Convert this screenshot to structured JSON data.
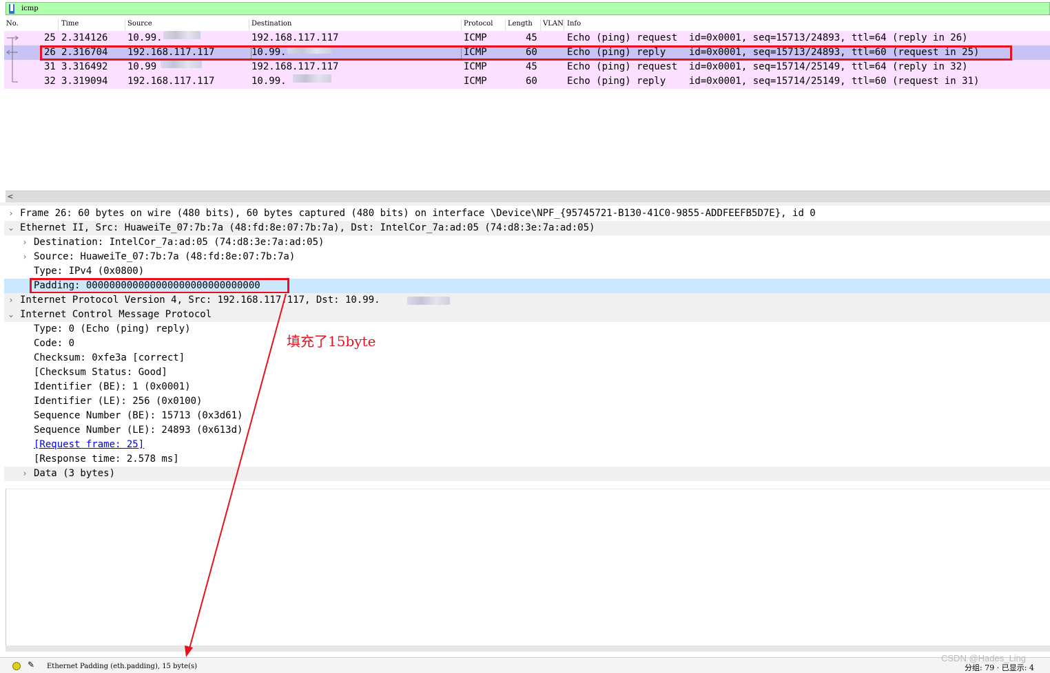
{
  "filter": {
    "value": "icmp",
    "bookmark_icon": "bookmark-icon"
  },
  "colors": {
    "filter_bg": "#afffaf",
    "row_icmp": "#fce0ff",
    "row_selected": "#c9c3f5",
    "detail_selected": "#cce8ff",
    "highlight_red": "#e8101e"
  },
  "packet_list": {
    "columns": [
      "No.",
      "Time",
      "Source",
      "Destination",
      "Protocol",
      "Length",
      "VLAN",
      "Info"
    ],
    "rows": [
      {
        "no": "25",
        "time": "2.314126",
        "source": "10.99.",
        "destination": "192.168.117.117",
        "protocol": "ICMP",
        "length": "45",
        "vlan": "",
        "info": "Echo (ping) request  id=0x0001, seq=15713/24893, ttl=64 (reply in 26)"
      },
      {
        "no": "26",
        "time": "2.316704",
        "source": "192.168.117.117",
        "destination": "10.99.",
        "protocol": "ICMP",
        "length": "60",
        "vlan": "",
        "info": "Echo (ping) reply    id=0x0001, seq=15713/24893, ttl=60 (request in 25)"
      },
      {
        "no": "31",
        "time": "3.316492",
        "source": "10.99",
        "destination": "192.168.117.117",
        "protocol": "ICMP",
        "length": "45",
        "vlan": "",
        "info": "Echo (ping) request  id=0x0001, seq=15714/25149, ttl=64 (reply in 32)"
      },
      {
        "no": "32",
        "time": "3.319094",
        "source": "192.168.117.117",
        "destination": "10.99.",
        "protocol": "ICMP",
        "length": "60",
        "vlan": "",
        "info": "Echo (ping) reply    id=0x0001, seq=15714/25149, ttl=60 (request in 31)"
      }
    ],
    "scroll_left": "<"
  },
  "details": {
    "frame": "Frame 26: 60 bytes on wire (480 bits), 60 bytes captured (480 bits) on interface \\Device\\NPF_{95745721-B130-41C0-9855-ADDFEEFB5D7E}, id 0",
    "ethernet": "Ethernet II, Src: HuaweiTe_07:7b:7a (48:fd:8e:07:7b:7a), Dst: IntelCor_7a:ad:05 (74:d8:3e:7a:ad:05)",
    "eth_dst": "Destination: IntelCor_7a:ad:05 (74:d8:3e:7a:ad:05)",
    "eth_src": "Source: HuaweiTe_07:7b:7a (48:fd:8e:07:7b:7a)",
    "eth_type": "Type: IPv4 (0x0800)",
    "eth_padding": "Padding: 000000000000000000000000000000",
    "ip": "Internet Protocol Version 4, Src: 192.168.117.117, Dst: 10.99.",
    "icmp": "Internet Control Message Protocol",
    "icmp_type": "Type: 0 (Echo (ping) reply)",
    "icmp_code": "Code: 0",
    "icmp_checksum": "Checksum: 0xfe3a [correct]",
    "icmp_checksum_status": "[Checksum Status: Good]",
    "icmp_id_be": "Identifier (BE): 1 (0x0001)",
    "icmp_id_le": "Identifier (LE): 256 (0x0100)",
    "icmp_seq_be": "Sequence Number (BE): 15713 (0x3d61)",
    "icmp_seq_le": "Sequence Number (LE): 24893 (0x613d)",
    "icmp_request_frame": "[Request frame: 25]",
    "icmp_response_time": "[Response time: 2.578 ms]",
    "data": "Data (3 bytes)"
  },
  "annotation": "填充了15byte",
  "status": {
    "text": "Ethernet Padding (eth.padding), 15 byte(s)",
    "right": "分组: 79 · 已显示: 4"
  },
  "watermark": "CSDN @Hades_Ling"
}
